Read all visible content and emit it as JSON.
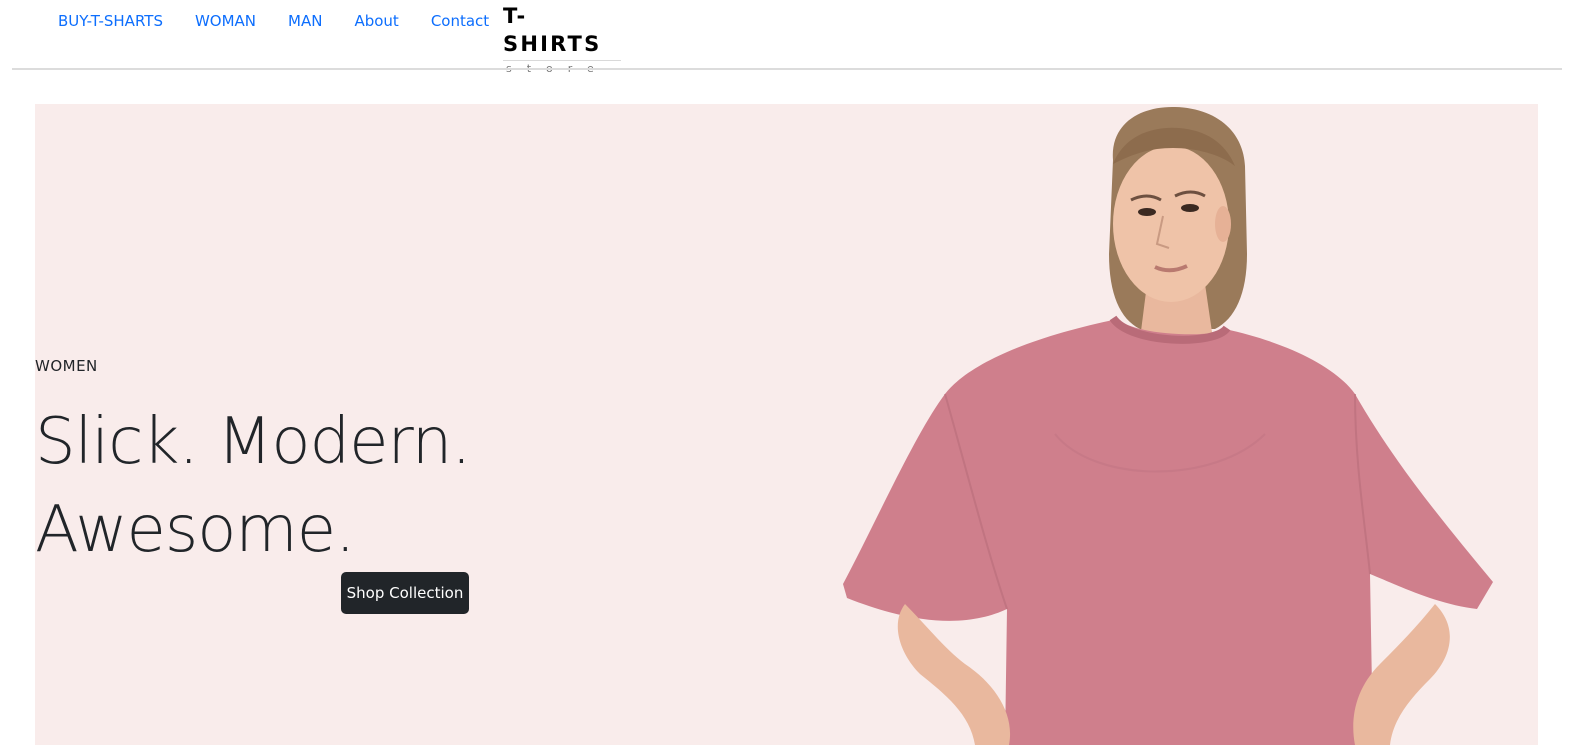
{
  "nav": {
    "links": [
      "BUY-T-SHARTS",
      "WOMAN",
      "MAN",
      "About",
      "Contact"
    ]
  },
  "logo": {
    "main": "T-SHIRTS",
    "sub": "store"
  },
  "hero": {
    "kicker": "WOMEN",
    "headline_line1": "Slick. Modern.",
    "headline_line2": "Awesome.",
    "cta_label": "Shop Collection",
    "background_color": "#f9eceb",
    "shirt_color": "#cf7f8c"
  },
  "colors": {
    "link": "#0d6efd",
    "text": "#212529",
    "button_bg": "#212529"
  }
}
